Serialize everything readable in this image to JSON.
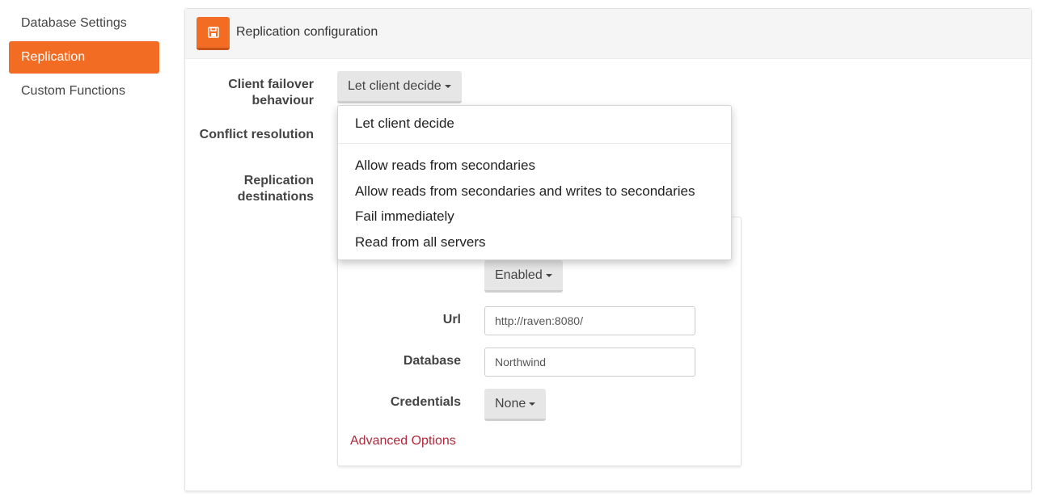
{
  "sidebar": {
    "items": [
      {
        "label": "Database Settings",
        "active": false
      },
      {
        "label": "Replication",
        "active": true
      },
      {
        "label": "Custom Functions",
        "active": false
      }
    ]
  },
  "panel": {
    "title": "Replication configuration",
    "save_icon": "floppy-disk-icon"
  },
  "form": {
    "failover_label_line1": "Client failover",
    "failover_label_line2": "behaviour",
    "failover_value": "Let client decide",
    "conflict_label": "Conflict resolution",
    "destinations_label_line1": "Replication",
    "destinations_label_line2": "destinations"
  },
  "destination": {
    "status_value": "Enabled",
    "url_label": "Url",
    "url_value": "http://raven:8080/",
    "database_label": "Database",
    "database_value": "Northwind",
    "credentials_label": "Credentials",
    "credentials_value": "None",
    "advanced_link": "Advanced Options"
  },
  "failover_menu": {
    "items": [
      "Let client decide",
      "Allow reads from secondaries",
      "Allow reads from secondaries and writes to secondaries",
      "Fail immediately",
      "Read from all servers"
    ]
  },
  "colors": {
    "accent": "#f26d23",
    "link": "#b1283a"
  }
}
